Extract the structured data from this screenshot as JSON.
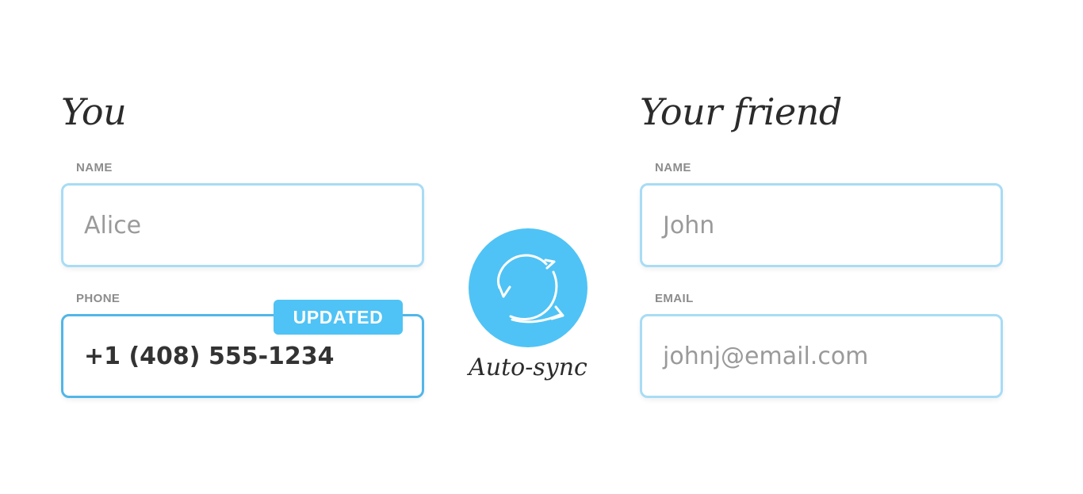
{
  "you_panel": {
    "heading": "You",
    "name_field": {
      "label": "NAME",
      "value": "Alice"
    },
    "phone_field": {
      "label": "PHONE",
      "value": "+1 (408) 555-1234",
      "badge": "UPDATED"
    }
  },
  "friend_panel": {
    "heading": "Your friend",
    "name_field": {
      "label": "NAME",
      "value": "John"
    },
    "email_field": {
      "label": "EMAIL",
      "value": "johnj@email.com"
    }
  },
  "sync": {
    "label": "Auto-sync",
    "icon": "refresh-icon"
  },
  "colors": {
    "accent": "#4fc3f5",
    "field_border": "#a8dcf5",
    "field_border_active": "#52b6e8",
    "label_text": "#8c8c8c",
    "placeholder_text": "#9a9a9a",
    "strong_text": "#333333"
  }
}
